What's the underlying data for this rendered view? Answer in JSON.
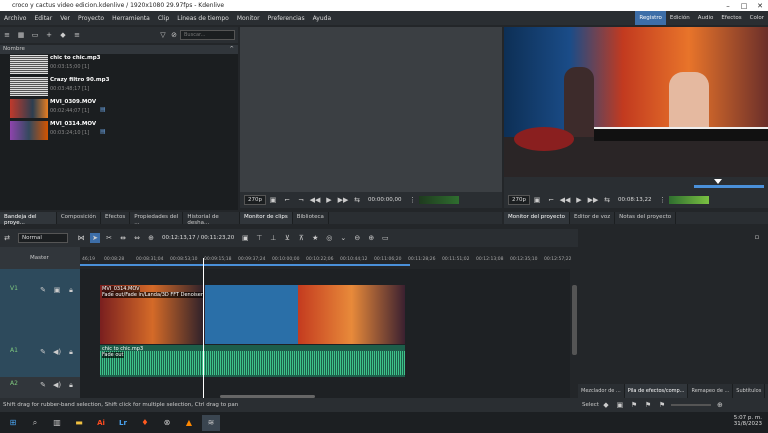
{
  "title": "croco y cactus video edicion.kdenlive / 1920x1080 29.97fps - Kdenlive",
  "menu": [
    "Archivo",
    "Editar",
    "Ver",
    "Proyecto",
    "Herramienta",
    "Clip",
    "Líneas de tiempo",
    "Monitor",
    "Preferencias",
    "Ayuda"
  ],
  "workspaces": [
    "Registro",
    "Edición",
    "Audio",
    "Efectos",
    "Color"
  ],
  "bin": {
    "search_placeholder": "Buscar...",
    "col": "Nombre",
    "clips": [
      {
        "name": "chic to chic.mp3",
        "dur": "00:03:15;00 [1]"
      },
      {
        "name": "Crazy filtro 90.mp3",
        "dur": "00:03:48;17 [1]"
      },
      {
        "name": "MVI_0309.MOV",
        "dur": "00:02:44;07 [1]"
      },
      {
        "name": "MVI_0314.MOV",
        "dur": "00:03:24;10 [1]"
      }
    ]
  },
  "clipmon": {
    "zoom": "270p",
    "tc": "00:00:00,00"
  },
  "projmon": {
    "zoom": "270p",
    "tc": "00:08:13,22"
  },
  "tabs_left": [
    "Bandeja del proye...",
    "Composición",
    "Efectos",
    "Propiedades del ...",
    "Historial de desha..."
  ],
  "tabs_mid": [
    "Monitor de clips",
    "Biblioteca"
  ],
  "tabs_right": [
    "Monitor del proyecto",
    "Editor de voz",
    "Notas del proyecto"
  ],
  "timeline": {
    "mode": "Normal",
    "tc": "00:12:13,17 / 00:11:23,20",
    "master": "Master",
    "ticks": [
      "00:08:28",
      "00:08:31;04",
      "00:08:53;10",
      "00:09:15;18",
      "00:09:37;24",
      "00:10:00;00",
      "00:10:22;06",
      "00:10:44;12",
      "00:11:06;20",
      "00:11:28;26",
      "00:11:51;02",
      "00:12:13;08",
      "00:12:35;10",
      "00:12:57;22"
    ],
    "tracks": [
      {
        "id": "V1"
      },
      {
        "id": "A1"
      },
      {
        "id": "A2"
      }
    ],
    "video_clip": {
      "name": "MVI_0314.MOV",
      "effect": "Fade out/Fade in/Landa/3D FFT Denoiser"
    },
    "audio_clip": {
      "name": "chic to chic.mp3",
      "effect": "Fade out"
    },
    "first_tick": "46;19"
  },
  "right_tabs": [
    "Mezclador de ...",
    "Pila de efectos/comp...",
    "Remapeo de ...",
    "Subtítulos"
  ],
  "right_select": "Select",
  "status": "Shift drag for rubber-band selection, Shift click for multiple selection, Ctrl drag to pan",
  "clock": {
    "time": "5:07 p. m.",
    "date": "31/8/2023"
  }
}
